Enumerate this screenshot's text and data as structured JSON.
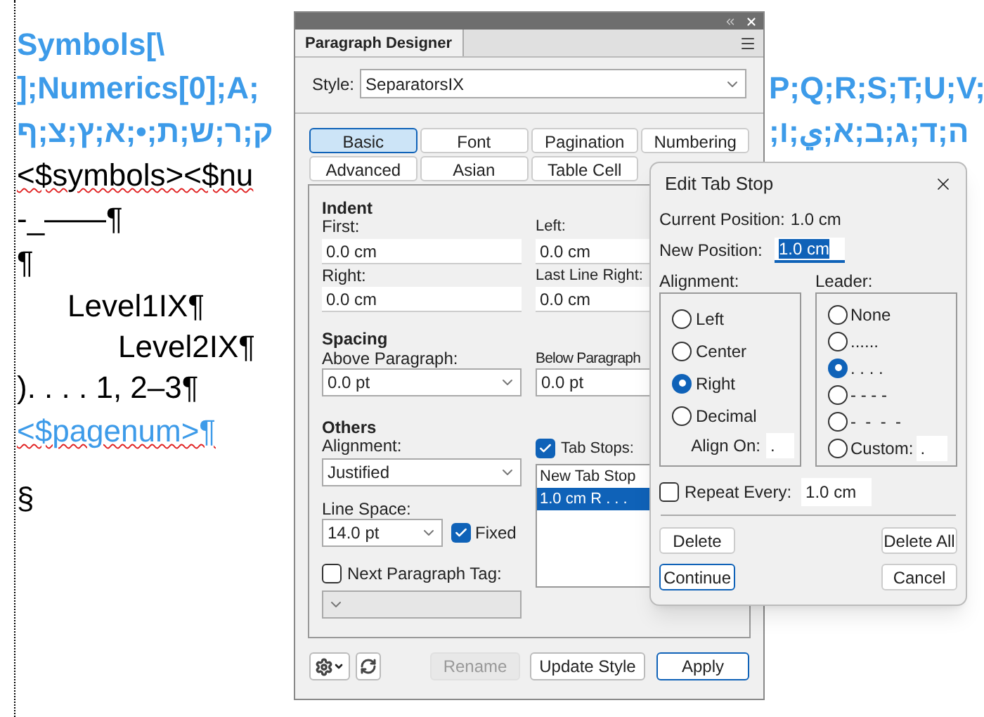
{
  "document": {
    "lines": [
      {
        "kind": "heading",
        "text": "Symbols[\\",
        "misspelled": false
      },
      {
        "kind": "heading",
        "text": "];Numerics[0];A;",
        "misspelled": false
      },
      {
        "kind": "heading_rtl",
        "text": "ק;ר;ש;ת;•;ﬡ;ץ;צ;ף",
        "misspelled": false
      },
      {
        "kind": "body",
        "text": "<$symbols><$nu",
        "misspelled": true
      },
      {
        "kind": "body",
        "text": "-_——¶",
        "misspelled": false
      },
      {
        "kind": "body",
        "text": "¶",
        "misspelled": false
      },
      {
        "kind": "level1",
        "text": "Level1IX¶",
        "misspelled": false
      },
      {
        "kind": "level2",
        "text": "Level2IX¶",
        "misspelled": false
      },
      {
        "kind": "body",
        "text": "). . . . 1, 2–3¶",
        "misspelled": false
      },
      {
        "kind": "variable",
        "text": "<$pagenum>¶",
        "misspelled": true
      },
      {
        "kind": "gap",
        "text": "§",
        "misspelled": false
      }
    ],
    "overflow": [
      {
        "kind": "ltr",
        "text": "P;Q;R;S;T;U;V;"
      },
      {
        "kind": "rtl",
        "text": "ה;ד;ג;ב;א;ي;ו;"
      }
    ]
  },
  "designer": {
    "title": "Paragraph Designer",
    "style_label": "Style:",
    "style_value": "SeparatorsIX",
    "tabs": [
      {
        "label": "Basic",
        "selected": true
      },
      {
        "label": "Font",
        "selected": false
      },
      {
        "label": "Pagination",
        "selected": false
      },
      {
        "label": "Numbering",
        "selected": false
      },
      {
        "label": "Advanced",
        "selected": false
      },
      {
        "label": "Asian",
        "selected": false
      },
      {
        "label": "Table Cell",
        "selected": false
      }
    ],
    "indent": {
      "heading": "Indent",
      "first_label": "First:",
      "first": "0.0 cm",
      "left_label": "Left:",
      "left": "0.0 cm",
      "right_label": "Right:",
      "right": "0.0 cm",
      "last_label": "Last Line Right:",
      "last": "0.0 cm"
    },
    "spacing": {
      "heading": "Spacing",
      "above_label": "Above Paragraph:",
      "above": "0.0 pt",
      "below_label": "Below Paragraph",
      "below": "0.0 pt"
    },
    "others": {
      "heading": "Others",
      "alignment_label": "Alignment:",
      "alignment": "Justified",
      "line_space_label": "Line Space:",
      "line_space": "14.0 pt",
      "fixed_label": "Fixed",
      "fixed": true,
      "next_tag_label": "Next Paragraph Tag:",
      "next_tag": false
    },
    "tab_stops": {
      "label": "Tab Stops:",
      "checked": true,
      "items": [
        {
          "text": "New Tab Stop",
          "selected": false
        },
        {
          "text": "1.0 cm R . . .",
          "selected": true
        }
      ]
    },
    "buttons": [
      {
        "label": "Rename",
        "disabled": true,
        "primary": false
      },
      {
        "label": "Update Style",
        "disabled": false,
        "primary": false
      },
      {
        "label": "Apply",
        "disabled": false,
        "primary": true
      }
    ]
  },
  "edit_tab_stop": {
    "title": "Edit Tab Stop",
    "current_label": "Current Position:",
    "current": "1.0 cm",
    "new_label": "New Position:",
    "new": "1.0 cm",
    "alignment_label": "Alignment:",
    "alignments": [
      {
        "label": "Left",
        "selected": false
      },
      {
        "label": "Center",
        "selected": false
      },
      {
        "label": "Right",
        "selected": true
      },
      {
        "label": "Decimal",
        "selected": false
      }
    ],
    "align_on_label": "Align On:",
    "align_on": ".",
    "leader_label": "Leader:",
    "leaders": [
      {
        "label": "None",
        "selected": false
      },
      {
        "label": "......",
        "selected": false
      },
      {
        "label": ". . . .",
        "selected": true
      },
      {
        "label": "- - - -",
        "selected": false
      },
      {
        "label": "-  -  -  -",
        "selected": false
      },
      {
        "label": "Custom:",
        "selected": false
      }
    ],
    "custom": ".",
    "repeat_label": "Repeat Every:",
    "repeat": false,
    "repeat_value": "1.0 cm",
    "buttons": [
      "Delete",
      "Delete All",
      "Continue",
      "Cancel"
    ]
  }
}
